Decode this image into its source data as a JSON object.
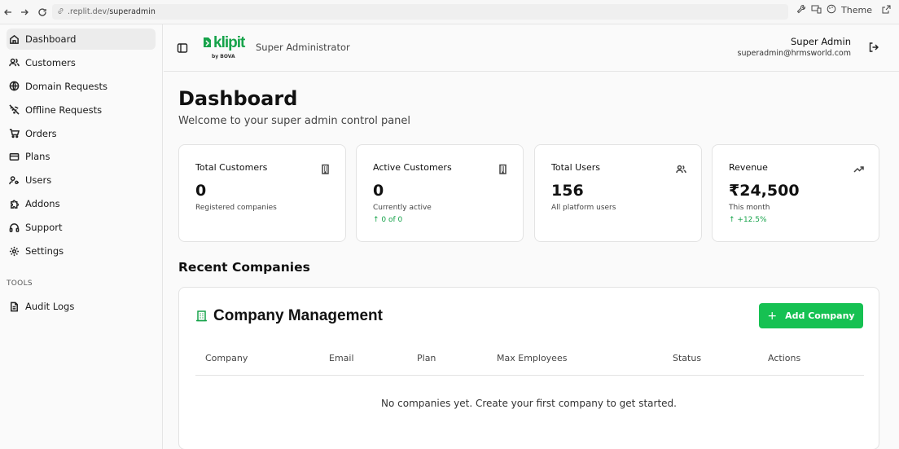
{
  "browser": {
    "url_prefix": ".replit.dev/",
    "url_path": "superadmin",
    "theme_label": "Theme"
  },
  "sidebar": {
    "items": [
      {
        "label": "Dashboard",
        "icon": "home-icon",
        "active": true
      },
      {
        "label": "Customers",
        "icon": "users-icon"
      },
      {
        "label": "Domain Requests",
        "icon": "globe-icon"
      },
      {
        "label": "Offline Requests",
        "icon": "wifi-off-icon"
      },
      {
        "label": "Orders",
        "icon": "cart-icon"
      },
      {
        "label": "Plans",
        "icon": "credit-card-icon"
      },
      {
        "label": "Users",
        "icon": "user-key-icon"
      },
      {
        "label": "Addons",
        "icon": "puzzle-icon"
      },
      {
        "label": "Support",
        "icon": "headphones-icon"
      },
      {
        "label": "Settings",
        "icon": "gear-icon"
      }
    ],
    "tools_heading": "TOOLS",
    "tools_items": [
      {
        "label": "Audit Logs",
        "icon": "file-text-icon"
      }
    ]
  },
  "header": {
    "logo_text": "klipit",
    "logo_sub": "by BOVA",
    "role": "Super Administrator",
    "user_name": "Super Admin",
    "user_email": "superadmin@hrmsworld.com"
  },
  "main": {
    "title": "Dashboard",
    "subtitle": "Welcome to your super admin control panel",
    "cards": [
      {
        "title": "Total Customers",
        "value": "0",
        "sub": "Registered companies",
        "growth": "",
        "icon": "building-icon"
      },
      {
        "title": "Active Customers",
        "value": "0",
        "sub": "Currently active",
        "growth": "↑ 0 of 0",
        "icon": "building-icon"
      },
      {
        "title": "Total Users",
        "value": "156",
        "sub": "All platform users",
        "growth": "",
        "icon": "users-icon"
      },
      {
        "title": "Revenue",
        "value": "₹24,500",
        "sub": "This month",
        "growth": "↑ +12.5%",
        "icon": "trending-up-icon"
      }
    ],
    "recent_heading": "Recent Companies",
    "panel": {
      "title": "Company Management",
      "add_button": "Add Company",
      "columns": [
        "Company",
        "Email",
        "Plan",
        "Max Employees",
        "Status",
        "Actions"
      ],
      "empty_text": "No companies yet. Create your first company to get started."
    }
  },
  "colors": {
    "accent": "#16c152",
    "brand": "#16a34a",
    "growth": "#16a34a"
  }
}
